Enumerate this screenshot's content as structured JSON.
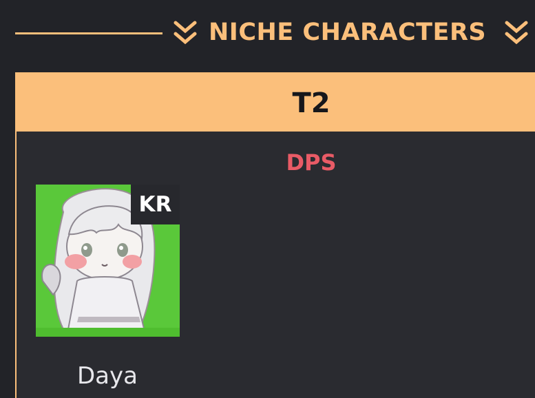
{
  "section": {
    "title": "NICHE CHARACTERS",
    "icons": [
      "chevrons-down-icon",
      "chevrons-down-icon"
    ],
    "accent_color": "#fbbf7b"
  },
  "tier": {
    "label": "T2",
    "header_color": "#fbbf7b",
    "role": "DPS",
    "role_color": "#e95b66",
    "characters": [
      {
        "name": "Daya",
        "badge": "KR",
        "portrait_bg": "#5ac83a"
      }
    ]
  }
}
